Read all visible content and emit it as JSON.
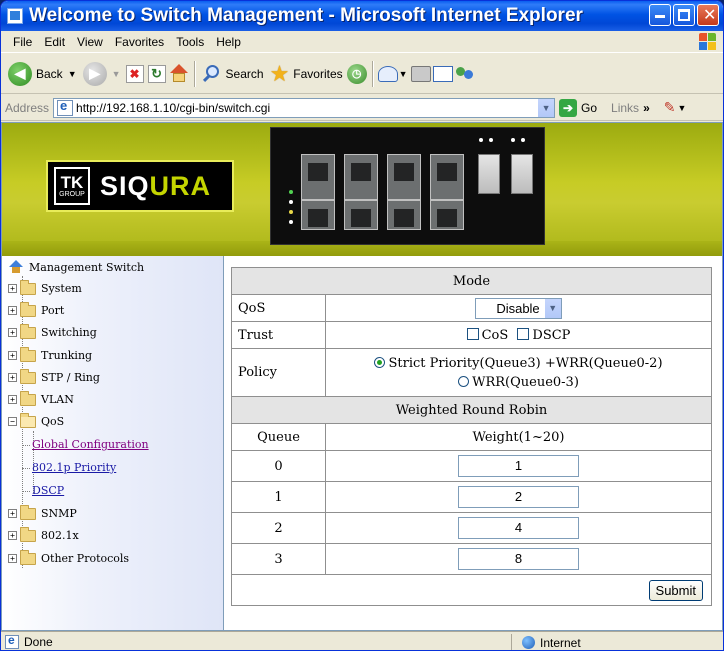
{
  "window": {
    "title": "Welcome to Switch Management - Microsoft Internet Explorer"
  },
  "menubar": {
    "items": [
      "File",
      "Edit",
      "View",
      "Favorites",
      "Tools",
      "Help"
    ]
  },
  "toolbar": {
    "back_label": "Back",
    "search_label": "Search",
    "favorites_label": "Favorites"
  },
  "addressbar": {
    "label": "Address",
    "url": "http://192.168.1.10/cgi-bin/switch.cgi",
    "go_label": "Go",
    "links_label": "Links"
  },
  "banner": {
    "logo_tk": "TK",
    "logo_group": "GROUP",
    "logo_name_a": "SIQ",
    "logo_name_b": "URA"
  },
  "sidebar": {
    "root": "Management Switch",
    "items": [
      "System",
      "Port",
      "Switching",
      "Trunking",
      "STP / Ring",
      "VLAN",
      "QoS"
    ],
    "qos_children": [
      "Global Configuration",
      "802.1p Priority",
      "DSCP"
    ],
    "items_after": [
      "SNMP",
      "802.1x",
      "Other Protocols"
    ]
  },
  "form": {
    "mode_header": "Mode",
    "qos_label": "QoS",
    "qos_value": "Disable",
    "trust_label": "Trust",
    "trust_cos": "CoS",
    "trust_dscp": "DSCP",
    "policy_label": "Policy",
    "policy_option1": "Strict Priority(Queue3) +WRR(Queue0-2)",
    "policy_option2": "WRR(Queue0-3)",
    "wrr_header": "Weighted Round Robin",
    "queue_col": "Queue",
    "weight_col": "Weight(1~20)",
    "rows": [
      {
        "queue": "0",
        "weight": "1"
      },
      {
        "queue": "1",
        "weight": "2"
      },
      {
        "queue": "2",
        "weight": "4"
      },
      {
        "queue": "3",
        "weight": "8"
      }
    ],
    "submit_label": "Submit"
  },
  "statusbar": {
    "status": "Done",
    "zone": "Internet"
  }
}
